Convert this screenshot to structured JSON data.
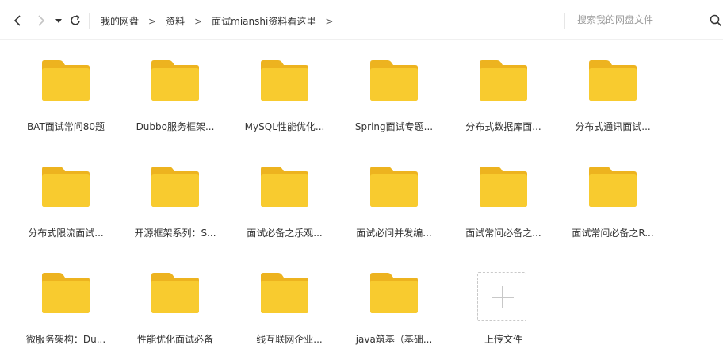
{
  "breadcrumb": [
    {
      "label": "我的网盘"
    },
    {
      "label": "资料"
    },
    {
      "label": "面试mianshi资料看这里"
    }
  ],
  "crumb_separator": ">",
  "search": {
    "placeholder": "搜索我的网盘文件"
  },
  "folders": [
    {
      "label": "BAT面试常问80题"
    },
    {
      "label": "Dubbo服务框架..."
    },
    {
      "label": "MySQL性能优化..."
    },
    {
      "label": "Spring面试专题..."
    },
    {
      "label": "分布式数据库面..."
    },
    {
      "label": "分布式通讯面试..."
    },
    {
      "label": "分布式限流面试..."
    },
    {
      "label": "开源框架系列：S..."
    },
    {
      "label": "面试必备之乐观..."
    },
    {
      "label": "面试必问并发编..."
    },
    {
      "label": "面试常问必备之..."
    },
    {
      "label": "面试常问必备之R..."
    },
    {
      "label": "微服务架构：Du..."
    },
    {
      "label": "性能优化面试必备"
    },
    {
      "label": "一线互联网企业..."
    },
    {
      "label": "java筑基（基础..."
    }
  ],
  "upload": {
    "label": "上传文件"
  },
  "colors": {
    "folder_back": "#EDB31F",
    "folder_front": "#F8CB2F"
  }
}
